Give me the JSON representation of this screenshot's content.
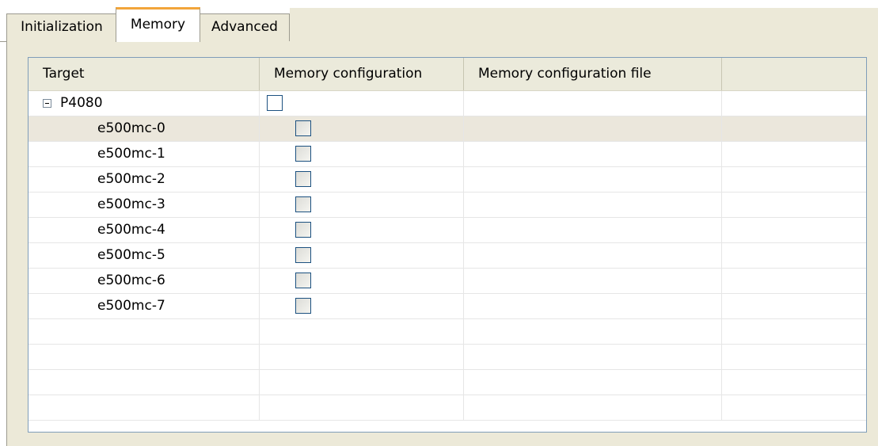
{
  "tabs": [
    {
      "label": "Initialization",
      "active": false
    },
    {
      "label": "Memory",
      "active": true
    },
    {
      "label": "Advanced",
      "active": false
    }
  ],
  "table": {
    "columns": [
      "Target",
      "Memory configuration",
      "Memory configuration file",
      ""
    ],
    "parent": {
      "label": "P4080",
      "checked": false,
      "expanded": true,
      "config_file": ""
    },
    "children": [
      {
        "label": "e500mc-0",
        "checked": false,
        "config_file": "",
        "selected": true
      },
      {
        "label": "e500mc-1",
        "checked": false,
        "config_file": ""
      },
      {
        "label": "e500mc-2",
        "checked": false,
        "config_file": ""
      },
      {
        "label": "e500mc-3",
        "checked": false,
        "config_file": ""
      },
      {
        "label": "e500mc-4",
        "checked": false,
        "config_file": ""
      },
      {
        "label": "e500mc-5",
        "checked": false,
        "config_file": ""
      },
      {
        "label": "e500mc-6",
        "checked": false,
        "config_file": ""
      },
      {
        "label": "e500mc-7",
        "checked": false,
        "config_file": ""
      }
    ]
  },
  "colors": {
    "active_tab_accent": "#f2a53a",
    "panel_background": "#ece9d8",
    "selected_row": "#ebe7dc",
    "checkbox_border": "#1c5180"
  }
}
